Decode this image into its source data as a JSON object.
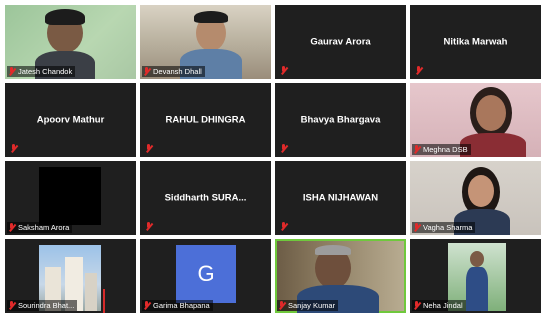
{
  "participants": [
    {
      "name": "Jatesh Chandok",
      "type": "video",
      "muted": true
    },
    {
      "name": "Devansh Dhall",
      "type": "video",
      "muted": true
    },
    {
      "name": "Gaurav Arora",
      "type": "name",
      "muted": true
    },
    {
      "name": "Nitika Marwah",
      "type": "name",
      "muted": true
    },
    {
      "name": "Apoorv Mathur",
      "type": "name",
      "muted": true
    },
    {
      "name": "RAHUL DHINGRA",
      "type": "name",
      "muted": true
    },
    {
      "name": "Bhavya Bhargava",
      "type": "name",
      "muted": true
    },
    {
      "name": "Meghna DSB",
      "type": "video",
      "muted": true
    },
    {
      "name": "Saksham Arora",
      "type": "blank",
      "muted": true
    },
    {
      "name": "Siddharth  SURA...",
      "type": "name",
      "muted": true
    },
    {
      "name": "ISHA NIJHAWAN",
      "type": "name",
      "muted": true
    },
    {
      "name": "Vagha Sharma",
      "type": "video",
      "muted": true
    },
    {
      "name": "Sourindra Bhat...",
      "type": "video",
      "muted": true
    },
    {
      "name": "Garima Bhapana",
      "type": "avatar",
      "avatar_letter": "G",
      "muted": true
    },
    {
      "name": "Sanjay Kumar",
      "type": "video",
      "muted": true,
      "active_speaker": true
    },
    {
      "name": "Neha Jindal",
      "type": "video",
      "muted": true
    }
  ],
  "colors": {
    "tile_bg": "#1f1f1f",
    "muted_icon": "#e02a2a",
    "active_speaker_border": "#6fc83c",
    "avatar_bg": "#4c6fd8"
  },
  "icons": {
    "muted": "mic-muted-icon"
  }
}
